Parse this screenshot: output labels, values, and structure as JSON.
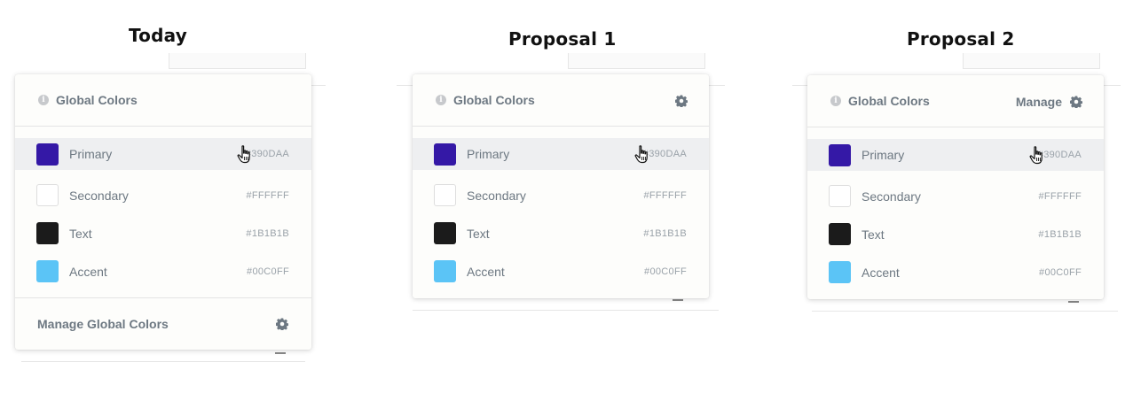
{
  "headings": {
    "today": "Today",
    "proposal1": "Proposal 1",
    "proposal2": "Proposal 2"
  },
  "panel": {
    "title": "Global Colors",
    "info_icon": "info-icon",
    "gear_icon": "gear-icon"
  },
  "colors": [
    {
      "name": "Primary",
      "hex": "#390DAA",
      "swatch": "#3418a6"
    },
    {
      "name": "Secondary",
      "hex": "#FFFFFF",
      "swatch": "#ffffff"
    },
    {
      "name": "Text",
      "hex": "#1B1B1B",
      "swatch": "#1b1b1b"
    },
    {
      "name": "Accent",
      "hex": "#00C0FF",
      "swatch": "#5bc4f6"
    }
  ],
  "today": {
    "footer_label": "Manage Global Colors"
  },
  "proposal2": {
    "manage_label": "Manage"
  },
  "theme": {
    "hover_row": "#eeeff1",
    "text_muted": "#6d7882"
  }
}
